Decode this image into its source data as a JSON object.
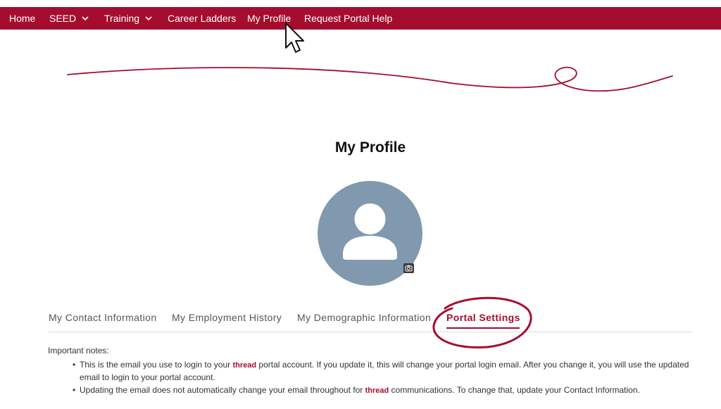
{
  "nav": {
    "home": "Home",
    "seed": "SEED",
    "training": "Training",
    "career_ladders": "Career Ladders",
    "my_profile": "My Profile",
    "request_help": "Request Portal Help"
  },
  "page": {
    "title": "My Profile"
  },
  "tabs": [
    {
      "label": "My Contact Information"
    },
    {
      "label": "My Employment History"
    },
    {
      "label": "My Demographic Information"
    },
    {
      "label": "Portal Settings",
      "active": true
    }
  ],
  "notes": {
    "heading": "Important notes:",
    "item1_a": "This is the email you use to login to your ",
    "item1_brand": "thread",
    "item1_b": " portal account. If you update it, this will change your portal login email. After you change it, you will use the updated email to login to your portal account.",
    "item2_a": "Updating the email does not automatically change your email throughout for ",
    "item2_brand": "thread",
    "item2_b": " communications. To change that, update your Contact Information."
  },
  "colors": {
    "brand": "#a50d2e",
    "avatar_bg": "#8099af"
  },
  "icons": {
    "avatar": "person-icon",
    "camera": "camera-icon",
    "chevron": "chevron-down-icon",
    "cursor": "mouse-pointer-icon"
  }
}
